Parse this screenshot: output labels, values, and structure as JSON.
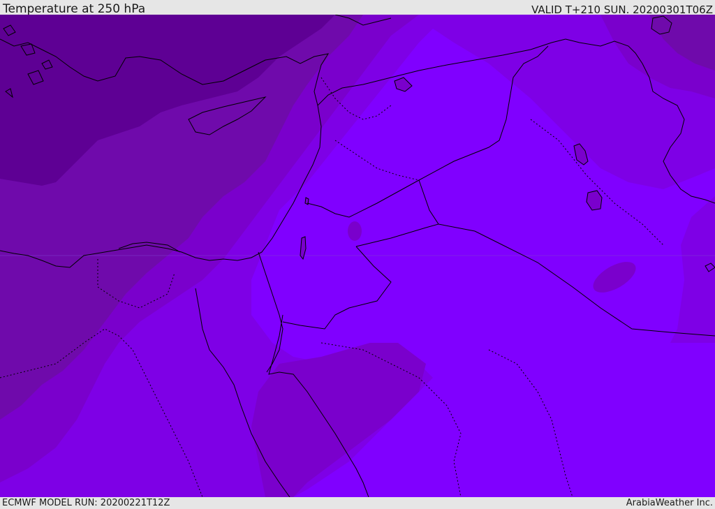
{
  "header": {
    "title": "Temperature at 250 hPa",
    "valid": "VALID T+210 SUN. 20200301T06Z"
  },
  "footer": {
    "model_run": "ECMWF MODEL RUN: 20200221T12Z",
    "credit": "ArabiaWeather Inc."
  },
  "colors": {
    "band_coldest": "#5e0094",
    "band_cold": "#6f0aab",
    "band_cool": "#7a00cc",
    "band_mild": "#7e00e6",
    "band_warm": "#8000ff",
    "coast_line": "#000000",
    "border_line": "#000000"
  }
}
